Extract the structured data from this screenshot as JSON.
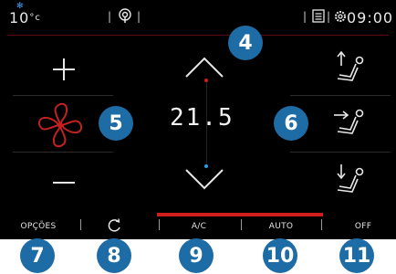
{
  "status": {
    "outside_temp": "10",
    "temp_unit": "°c",
    "clock": "09:00"
  },
  "climate": {
    "setpoint": "21.5",
    "indicator_colors": {
      "top": "#d21d1d",
      "bottom": "#2e9be6"
    }
  },
  "bottom_bar": {
    "options_label": "OPÇÕES",
    "ac_label": "A/C",
    "auto_label": "AUTO",
    "off_label": "OFF",
    "active_underline_color": "#d21d1d"
  },
  "callouts": [
    "4",
    "5",
    "6",
    "7",
    "8",
    "9",
    "10",
    "11"
  ]
}
